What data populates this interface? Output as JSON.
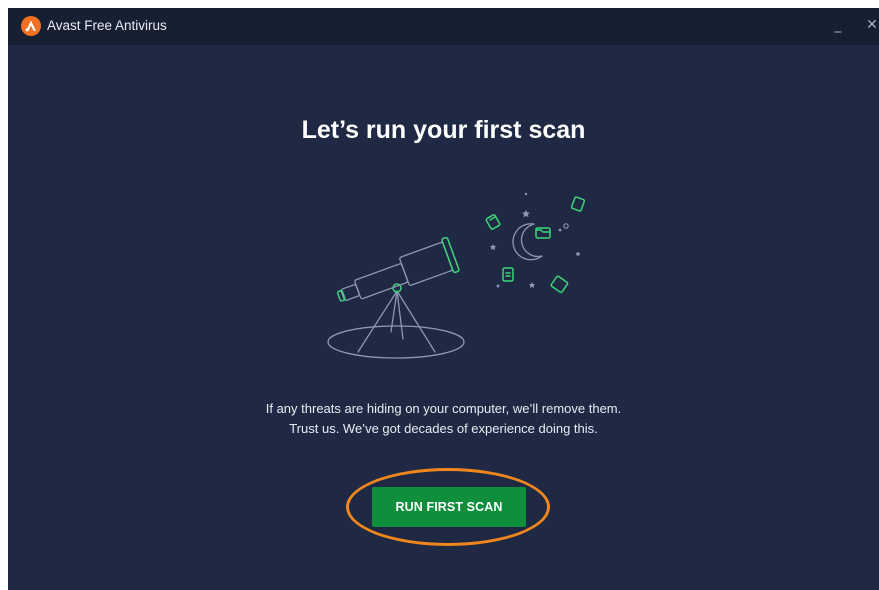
{
  "window": {
    "title": "Avast Free Antivirus",
    "logo_icon": "avast-logo-icon",
    "minimize_label": "_",
    "close_label": "✕"
  },
  "main": {
    "headline": "Let’s run your first scan",
    "illustration_icon": "telescope-night-sky-icon",
    "description_line1": "If any threats are hiding on your computer, we’ll remove them.",
    "description_line2": "Trust us. We’ve got decades of experience doing this.",
    "scan_button_label": "RUN FIRST SCAN"
  },
  "colors": {
    "background": "#1f2943",
    "titlebar": "#171f33",
    "accent_green": "#0f8e3c",
    "highlight_orange": "#f0861c",
    "brand_orange": "#f36f21"
  }
}
